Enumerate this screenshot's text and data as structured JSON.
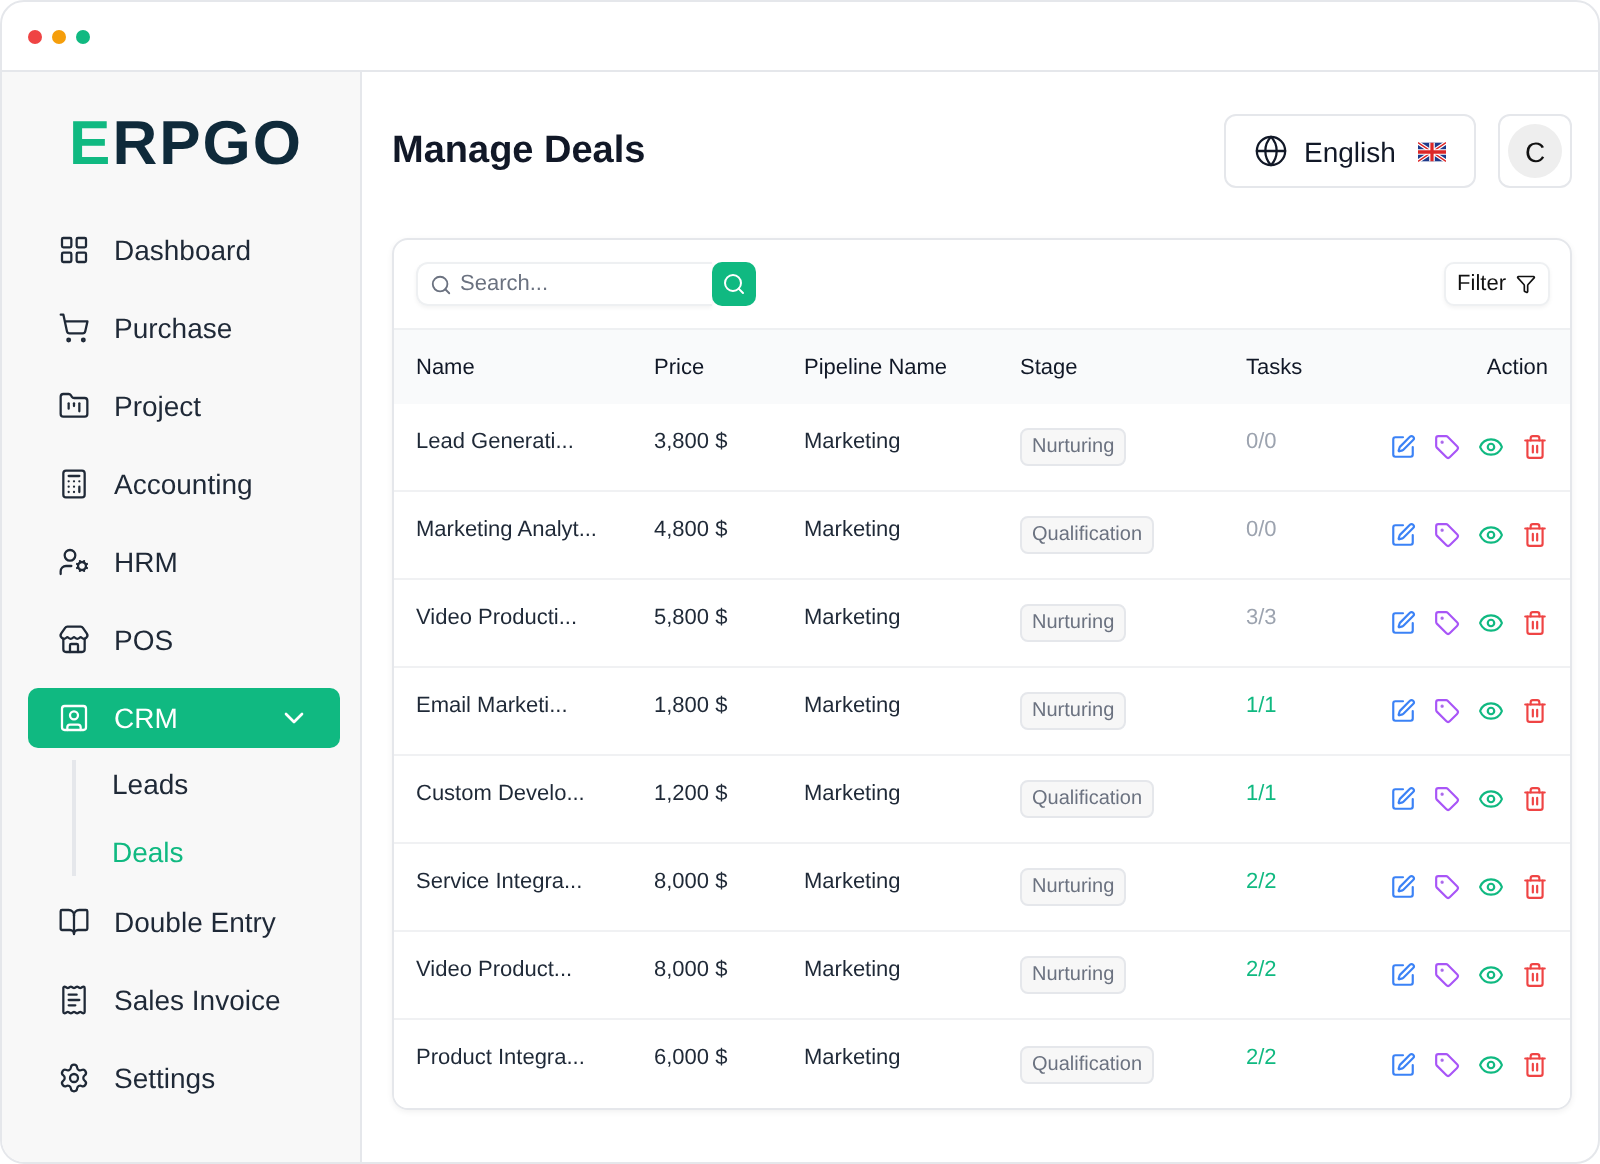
{
  "window": {
    "dots": [
      {
        "color": "#ef4444"
      },
      {
        "color": "#f59e0b"
      },
      {
        "color": "#10b981"
      }
    ]
  },
  "sidebar": {
    "logo": "ERPGO",
    "items": [
      {
        "label": "Dashboard",
        "selected": false
      },
      {
        "label": "Purchase",
        "selected": false
      },
      {
        "label": "Project",
        "selected": false
      },
      {
        "label": "Accounting",
        "selected": false
      },
      {
        "label": "HRM",
        "selected": false
      },
      {
        "label": "POS",
        "selected": false
      },
      {
        "label": "CRM",
        "selected": true,
        "expanded": true,
        "children": [
          {
            "label": "Leads",
            "selected": false
          },
          {
            "label": "Deals",
            "selected": true
          }
        ]
      },
      {
        "label": "Double Entry",
        "selected": false
      },
      {
        "label": "Sales Invoice",
        "selected": false
      },
      {
        "label": "Settings",
        "selected": false
      }
    ]
  },
  "header": {
    "title": "Manage Deals",
    "language": "English",
    "avatar": "C"
  },
  "toolbar": {
    "search": {
      "placeholder": "Search..."
    },
    "filter": "Filter"
  },
  "table": {
    "columns": [
      "Name",
      "Price",
      "Pipeline Name",
      "Stage",
      "Tasks",
      "Action"
    ],
    "rows": [
      {
        "name": "Lead Generati...",
        "price": "3,800 $",
        "pipeline": "Marketing",
        "stage": "Nurturing",
        "tasks": "0/0",
        "complete": false
      },
      {
        "name": "Marketing Analyt...",
        "price": "4,800 $",
        "pipeline": "Marketing",
        "stage": "Qualification",
        "tasks": "0/0",
        "complete": false
      },
      {
        "name": "Video Producti...",
        "price": "5,800 $",
        "pipeline": "Marketing",
        "stage": "Nurturing",
        "tasks": "3/3",
        "complete": false
      },
      {
        "name": "Email Marketi...",
        "price": "1,800 $",
        "pipeline": "Marketing",
        "stage": "Nurturing",
        "tasks": "1/1",
        "complete": true
      },
      {
        "name": "Custom Develo...",
        "price": "1,200 $",
        "pipeline": "Marketing",
        "stage": "Qualification",
        "tasks": "1/1",
        "complete": true
      },
      {
        "name": "Service Integra...",
        "price": "8,000 $",
        "pipeline": "Marketing",
        "stage": "Nurturing",
        "tasks": "2/2",
        "complete": true
      },
      {
        "name": "Video Product...",
        "price": "8,000 $",
        "pipeline": "Marketing",
        "stage": "Nurturing",
        "tasks": "2/2",
        "complete": true
      },
      {
        "name": "Product Integra...",
        "price": "6,000 $",
        "pipeline": "Marketing",
        "stage": "Qualification",
        "tasks": "2/2",
        "complete": true
      }
    ]
  }
}
